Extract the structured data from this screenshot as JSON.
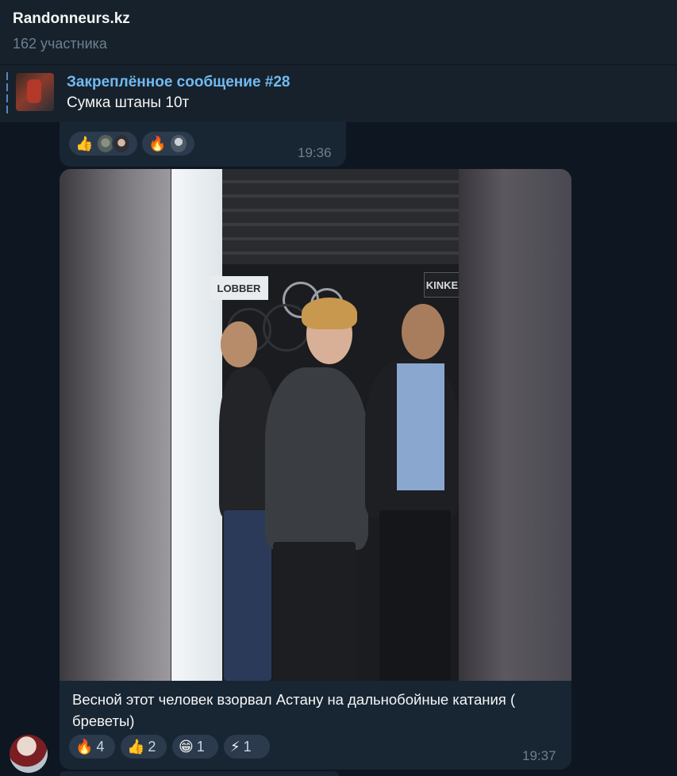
{
  "header": {
    "title": "Randonneurs.kz",
    "subtitle": "162 участника"
  },
  "pinned": {
    "title": "Закреплённое сообщение #28",
    "text": "Сумка штаны 10т"
  },
  "messages": [
    {
      "time": "19:36",
      "reactions": [
        {
          "emoji": "👍",
          "icon": "thumbs-up-icon"
        },
        {
          "emoji": "🔥",
          "icon": "fire-icon"
        }
      ]
    },
    {
      "time": "19:37",
      "photo_signs": [
        "LOBBER",
        "KINKE"
      ],
      "caption": "Весной этот человек взорвал Астану на дальнобойные катания ( бреветы)",
      "reactions": [
        {
          "emoji": "🔥",
          "count": "4",
          "icon": "fire-icon"
        },
        {
          "emoji": "👍",
          "count": "2",
          "icon": "thumbs-up-icon"
        },
        {
          "emoji": "😁",
          "count": "1",
          "icon": "grin-icon"
        },
        {
          "emoji": "⚡",
          "count": "1",
          "icon": "lightning-icon"
        }
      ]
    }
  ],
  "colors": {
    "background": "#0e1621",
    "header": "#17212b",
    "bubble": "#182533",
    "accent": "#71baf2",
    "reaction_bg": "#2b3b4d"
  }
}
